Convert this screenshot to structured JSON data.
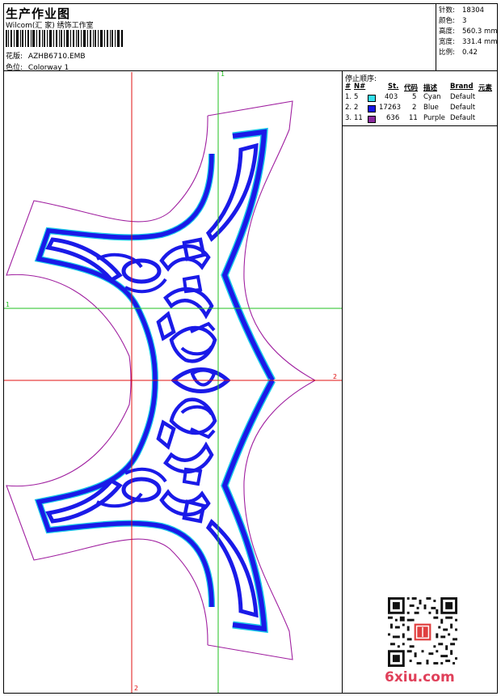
{
  "header": {
    "title": "生产作业图",
    "studio": "Wilcom(汇 家) 绣饰工作室",
    "design_label": "花版:",
    "design_value": "AZHB6710.EMB",
    "colorway_label": "色位:",
    "colorway_value": "Colorway 1"
  },
  "stats": [
    {
      "label": "针数:",
      "value": "18304"
    },
    {
      "label": "颜色:",
      "value": "3"
    },
    {
      "label": "高度:",
      "value": "560.3 mm"
    },
    {
      "label": "宽度:",
      "value": "331.4 mm"
    },
    {
      "label": "比例:",
      "value": "0.42"
    }
  ],
  "stop_sequence": {
    "title": "停止顺序:",
    "columns": [
      "#",
      "N#",
      "St.",
      "代码",
      "描述",
      "Brand",
      "元素"
    ],
    "rows": [
      {
        "index": "1.",
        "needle": "5",
        "stitches": "403",
        "code": "5",
        "desc": "Cyan",
        "brand": "Default",
        "color": "#33e0ee"
      },
      {
        "index": "2.",
        "needle": "2",
        "stitches": "17263",
        "code": "2",
        "desc": "Blue",
        "brand": "Default",
        "color": "#1616e6"
      },
      {
        "index": "3.",
        "needle": "11",
        "stitches": "636",
        "code": "11",
        "desc": "Purple",
        "brand": "Default",
        "color": "#8a2a9e"
      }
    ]
  },
  "guides": {
    "v1": "1",
    "v2": "2",
    "h1": "1",
    "h2": "2"
  },
  "colors": {
    "blue": "#1a1ae8",
    "cyan": "#19c8e8",
    "purple": "#a020a0",
    "red_guide": "#e01010",
    "green_guide": "#22c022"
  },
  "watermark": "6xiu.com"
}
